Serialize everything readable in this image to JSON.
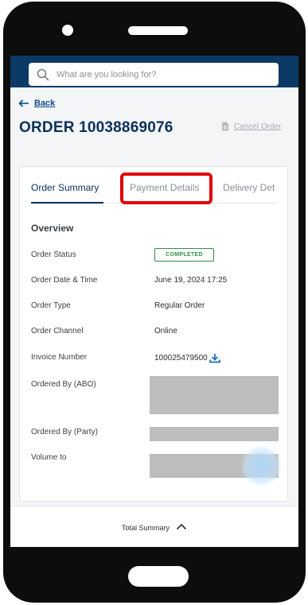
{
  "search": {
    "placeholder": "What are you looking for?"
  },
  "nav": {
    "back_label": "Back"
  },
  "order": {
    "title": "ORDER 10038869076",
    "cancel_label": "Cancel Order"
  },
  "tabs": [
    {
      "label": "Order Summary"
    },
    {
      "label": "Payment Details"
    },
    {
      "label": "Delivery Det"
    }
  ],
  "overview": {
    "heading": "Overview",
    "rows": [
      {
        "label": "Order Status",
        "value": "COMPLETED"
      },
      {
        "label": "Order Date & Time",
        "value": "June 19, 2024 17:25"
      },
      {
        "label": "Order Type",
        "value": "Regular Order"
      },
      {
        "label": "Order Channel",
        "value": "Online"
      },
      {
        "label": "Invoice Number",
        "value": "100025479500"
      },
      {
        "label": "Ordered By (ABO)",
        "value": ""
      },
      {
        "label": "Ordered By (Party)",
        "value": ""
      },
      {
        "label": "Volume to",
        "value": ""
      }
    ]
  },
  "footer": {
    "total_summary_label": "Total Summary"
  },
  "colors": {
    "brand_navy": "#0b2f57",
    "header_bg": "#0b3a66",
    "status_green": "#2f8f4a",
    "highlight_red": "#e00000",
    "link_blue": "#0b4a8a"
  },
  "icons": [
    "search-icon",
    "arrow-left-icon",
    "document-icon",
    "download-icon",
    "chevron-up-icon"
  ]
}
